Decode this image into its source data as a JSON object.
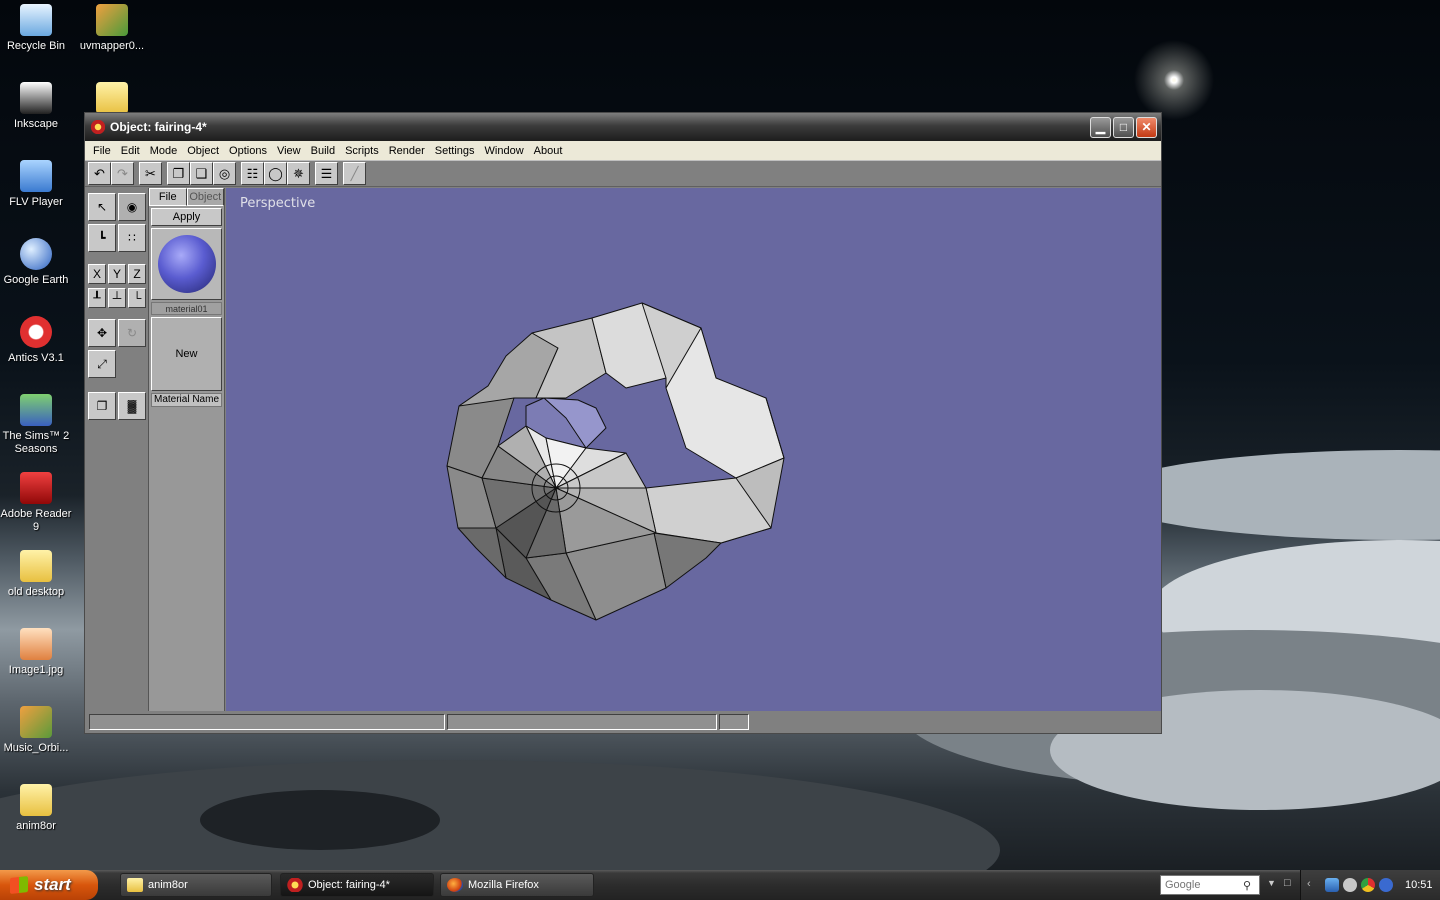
{
  "desktop": {
    "icons": [
      {
        "label": "Recycle Bin",
        "icon": "recycle-bin-icon",
        "color": "#6aa8e0"
      },
      {
        "label": "uvmapper0...",
        "icon": "uvmapper-icon",
        "color": "#4a9a3a"
      },
      {
        "label": "Inkscape",
        "icon": "inkscape-icon",
        "color": "#202020"
      },
      {
        "label": "FLV Player",
        "icon": "flv-player-icon",
        "color": "#3a7ad0"
      },
      {
        "label": "Google Earth",
        "icon": "google-earth-icon",
        "color": "#2a60c0"
      },
      {
        "label": "Antics V3.1",
        "icon": "antics-icon",
        "color": "#e03030"
      },
      {
        "label": "The Sims™ 2 Seasons",
        "icon": "sims-icon",
        "color": "#3aa050"
      },
      {
        "label": "Adobe Reader 9",
        "icon": "adobe-reader-icon",
        "color": "#c01010"
      },
      {
        "label": "old desktop",
        "icon": "folder-icon",
        "color": "#f0d060"
      },
      {
        "label": "Image1.jpg",
        "icon": "image-file-icon",
        "color": "#e08040"
      },
      {
        "label": "Music_Orbi...",
        "icon": "music-orbit-icon",
        "color": "#5a9a3a"
      },
      {
        "label": "anim8or",
        "icon": "folder-icon",
        "color": "#f0d060"
      }
    ]
  },
  "window": {
    "title": "Object: fairing-4*",
    "menu": [
      "File",
      "Edit",
      "Mode",
      "Object",
      "Options",
      "View",
      "Build",
      "Scripts",
      "Render",
      "Settings",
      "Window",
      "About"
    ],
    "viewport_label": "Perspective",
    "axes": {
      "x": "X",
      "y": "Y",
      "z": "Z"
    },
    "material_panel": {
      "tab_file": "File",
      "tab_object": "Object",
      "apply_label": "Apply",
      "material_label": "material01",
      "new_label": "New",
      "material_name_label": "Material Name"
    },
    "material_color": "#5a5cd0",
    "viewport_color": "#6868a0"
  },
  "taskbar": {
    "start_label": "start",
    "tasks": [
      {
        "label": "anim8or",
        "icon": "folder-icon"
      },
      {
        "label": "Object: fairing-4*",
        "icon": "anim8or-icon"
      },
      {
        "label": "Mozilla Firefox",
        "icon": "firefox-icon"
      }
    ],
    "search_placeholder": "Google",
    "clock": "10:51"
  }
}
